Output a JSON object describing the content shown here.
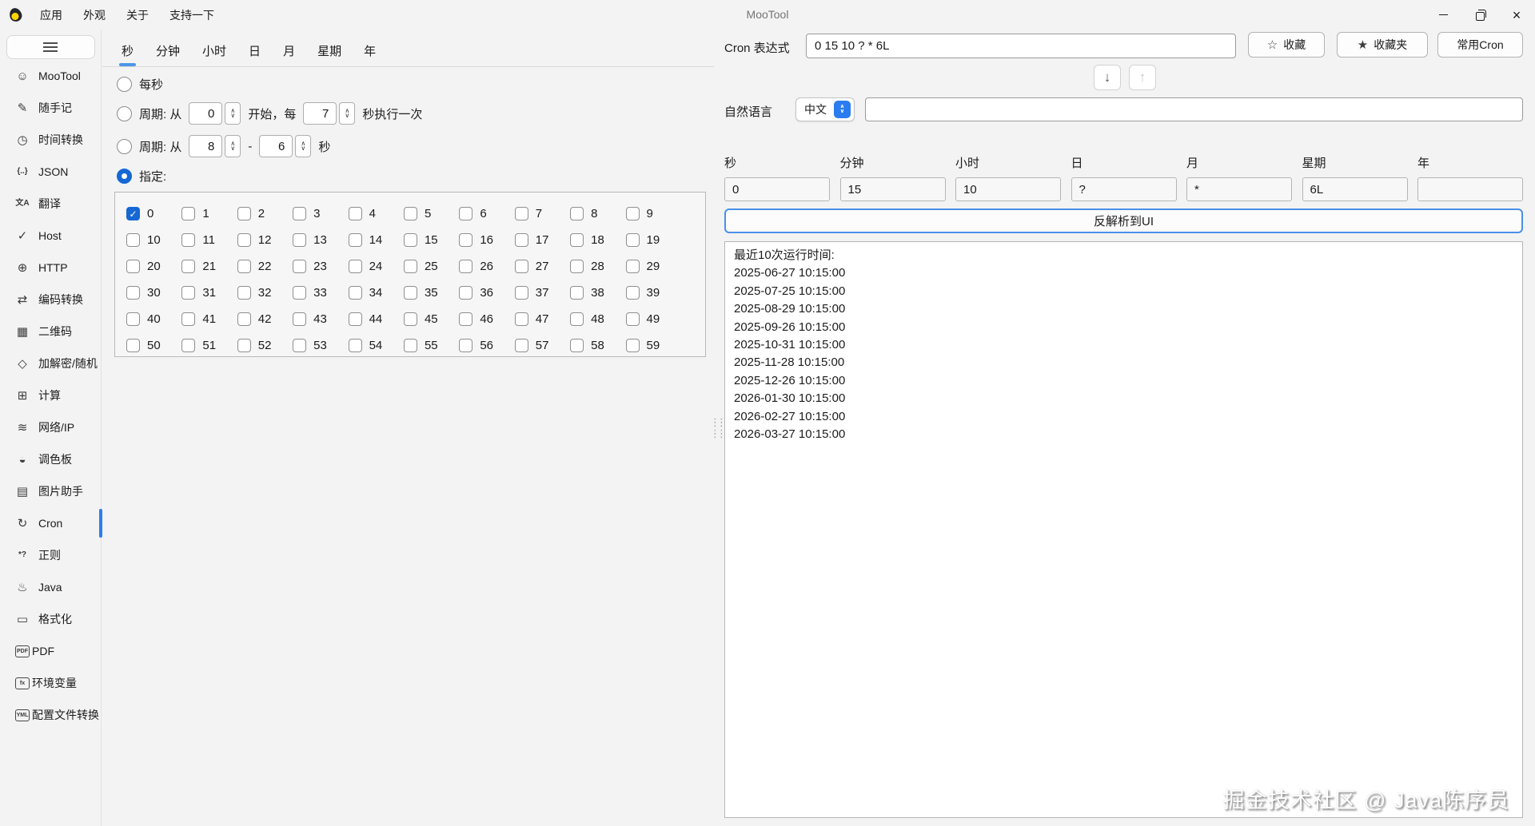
{
  "window": {
    "title": "MooTool"
  },
  "menu": {
    "items": [
      {
        "label": "应用"
      },
      {
        "label": "外观"
      },
      {
        "label": "关于"
      },
      {
        "label": "支持一下"
      }
    ]
  },
  "sidebar": {
    "items": [
      {
        "label": "MooTool",
        "glyph": "☺",
        "icon": "smiley-icon"
      },
      {
        "label": "随手记",
        "glyph": "✎",
        "icon": "pencil-icon"
      },
      {
        "label": "时间转换",
        "glyph": "◷",
        "icon": "clock-icon"
      },
      {
        "label": "JSON",
        "glyph": "{..}",
        "icon": "braces-icon",
        "small": true
      },
      {
        "label": "翻译",
        "glyph": "文A",
        "icon": "translate-icon",
        "small": true
      },
      {
        "label": "Host",
        "glyph": "✓",
        "icon": "check-icon"
      },
      {
        "label": "HTTP",
        "glyph": "⊕",
        "icon": "globe-icon"
      },
      {
        "label": "编码转换",
        "glyph": "⇄",
        "icon": "swap-arrows-icon"
      },
      {
        "label": "二维码",
        "glyph": "▦",
        "icon": "qrcode-icon"
      },
      {
        "label": "加解密/随机",
        "glyph": "◇",
        "icon": "cube-icon"
      },
      {
        "label": "计算",
        "glyph": "⊞",
        "icon": "calculator-icon"
      },
      {
        "label": "网络/IP",
        "glyph": "≋",
        "icon": "wifi-icon"
      },
      {
        "label": "调色板",
        "glyph": "◒",
        "icon": "palette-icon"
      },
      {
        "label": "图片助手",
        "glyph": "▤",
        "icon": "image-icon"
      },
      {
        "label": "Cron",
        "glyph": "↻",
        "icon": "cron-clock-icon",
        "active": true
      },
      {
        "label": "正则",
        "glyph": "*?",
        "icon": "regex-icon",
        "small": true
      },
      {
        "label": "Java",
        "glyph": "♨",
        "icon": "java-icon"
      },
      {
        "label": "格式化",
        "glyph": "▭",
        "icon": "paint-roller-icon"
      },
      {
        "label": "PDF",
        "glyph": "PDF",
        "icon": "pdf-icon",
        "boxed": true
      },
      {
        "label": "环境变量",
        "glyph": "fx",
        "icon": "fx-icon",
        "boxed": true
      },
      {
        "label": "配置文件转换",
        "glyph": "YML",
        "icon": "yml-icon",
        "boxed": true
      }
    ]
  },
  "tabs": {
    "items": [
      {
        "label": "秒",
        "active": true
      },
      {
        "label": "分钟"
      },
      {
        "label": "小时"
      },
      {
        "label": "日"
      },
      {
        "label": "月"
      },
      {
        "label": "星期"
      },
      {
        "label": "年"
      }
    ]
  },
  "options": {
    "every_label": "每秒",
    "cycle_prefix": "周期: 从",
    "cycle1_from": "0",
    "cycle1_mid": "开始，每",
    "cycle1_step": "7",
    "cycle1_suffix": "秒执行一次",
    "cycle2_from": "8",
    "cycle2_dash": "-",
    "cycle2_to": "6",
    "cycle2_suffix": "秒",
    "specify_label": "指定:"
  },
  "grid": {
    "min": 0,
    "max": 59,
    "checked": [
      0
    ]
  },
  "cron": {
    "label": "Cron 表达式",
    "value": "0 15 10 ? * 6L"
  },
  "toolbar": {
    "favorite": "收藏",
    "favorites": "收藏夹",
    "common": "常用Cron"
  },
  "natural": {
    "label": "自然语言",
    "language": "中文",
    "value": ""
  },
  "fields": {
    "items": [
      {
        "label": "秒",
        "value": "0"
      },
      {
        "label": "分钟",
        "value": "15"
      },
      {
        "label": "小时",
        "value": "10"
      },
      {
        "label": "日",
        "value": "?"
      },
      {
        "label": "月",
        "value": "*"
      },
      {
        "label": "星期",
        "value": "6L"
      },
      {
        "label": "年",
        "value": ""
      }
    ]
  },
  "parse": {
    "label": "反解析到UI"
  },
  "results": {
    "title": "最近10次运行时间:",
    "times": [
      "2025-06-27 10:15:00",
      "2025-07-25 10:15:00",
      "2025-08-29 10:15:00",
      "2025-09-26 10:15:00",
      "2025-10-31 10:15:00",
      "2025-11-28 10:15:00",
      "2025-12-26 10:15:00",
      "2026-01-30 10:15:00",
      "2026-02-27 10:15:00",
      "2026-03-27 10:15:00"
    ]
  },
  "watermark": "掘金技术社区 @ Java陈序员"
}
